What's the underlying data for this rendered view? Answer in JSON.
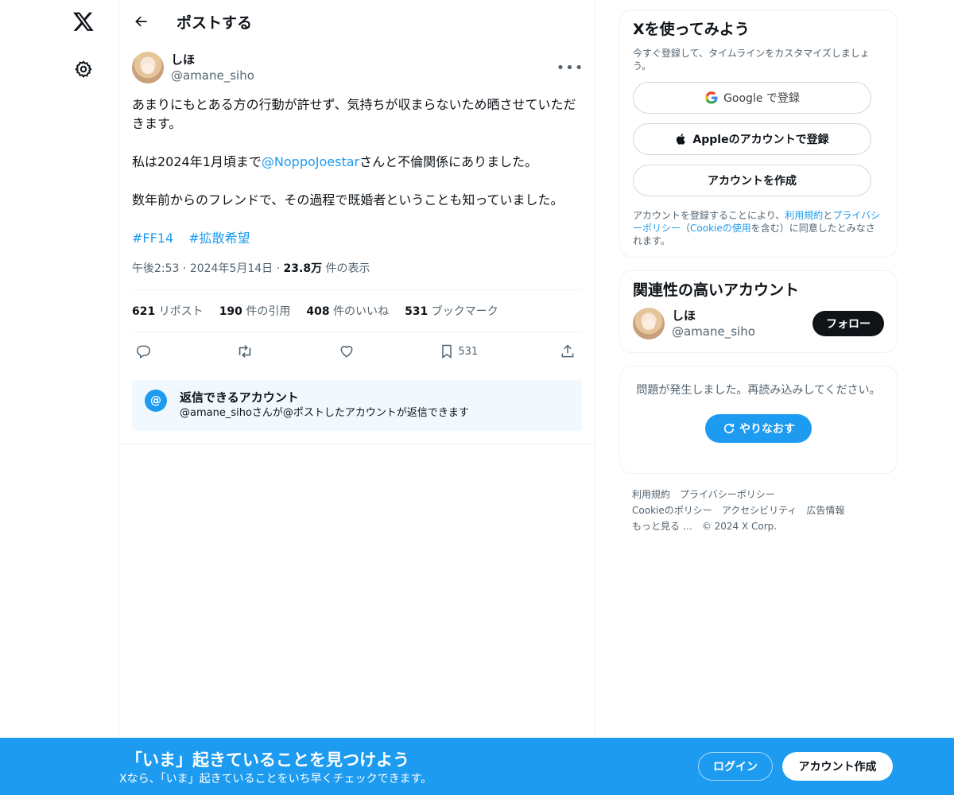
{
  "header": {
    "title": "ポストする"
  },
  "post": {
    "author_name": "しほ",
    "author_handle": "@amane_siho",
    "paragraph1": "あまりにもとある方の行動が許せず、気持ちが収まらないため晒させていただきます。",
    "paragraph2_before": "私は2024年1月頃まで",
    "paragraph2_mention": "@NoppoJoestar",
    "paragraph2_after": "さんと不倫関係にありました。",
    "paragraph3": "数年前からのフレンドで、その過程で既婚者ということも知っていました。",
    "tags": [
      "#FF14",
      "#拡散希望"
    ],
    "time": "午後2:53",
    "date": "2024年5月14日",
    "views_count": "23.8万",
    "views_label": "件の表示",
    "stats": {
      "reposts_count": "621",
      "reposts_label": "リポスト",
      "quotes_count": "190",
      "quotes_label": "件の引用",
      "likes_count": "408",
      "likes_label": "件のいいね",
      "bookmarks_count": "531",
      "bookmarks_label": "ブックマーク"
    },
    "bookmark_action_count": "531"
  },
  "reply_restriction": {
    "icon": "@",
    "title": "返信できるアカウント",
    "description": "@amane_sihoさんが@ポストしたアカウントが返信できます"
  },
  "sidebar": {
    "signup": {
      "title": "Xを使ってみよう",
      "subtitle": "今すぐ登録して、タイムラインをカスタマイズしましょう。",
      "google_label": "Google で登録",
      "apple_label": "Appleのアカウントで登録",
      "create_label": "アカウントを作成",
      "legal_1": "アカウントを登録することにより、",
      "legal_terms": "利用規約",
      "legal_and": "と",
      "legal_privacy": "プライバシーポリシー",
      "legal_paren_open": "（",
      "legal_cookie": "Cookieの使用",
      "legal_2": "を含む）に同意したとみなされます。"
    },
    "related": {
      "title": "関連性の高いアカウント",
      "name": "しほ",
      "handle": "@amane_siho",
      "follow_label": "フォロー"
    },
    "error": {
      "text": "問題が発生しました。再読み込みしてください。",
      "retry_label": "やりなおす"
    },
    "footer": {
      "terms": "利用規約",
      "privacy": "プライバシーポリシー",
      "cookie": "Cookieのポリシー",
      "accessibility": "アクセシビリティ",
      "ads": "広告情報",
      "more": "もっと見る …",
      "copyright": "© 2024 X Corp."
    }
  },
  "bottom_bar": {
    "title": "「いま」起きていることを見つけよう",
    "subtitle": "Xなら、「いま」起きていることをいち早くチェックできます。",
    "login_label": "ログイン",
    "create_label": "アカウント作成"
  },
  "colors": {
    "accent": "#1d9bf0",
    "text": "#0f1419",
    "secondary": "#536471"
  }
}
